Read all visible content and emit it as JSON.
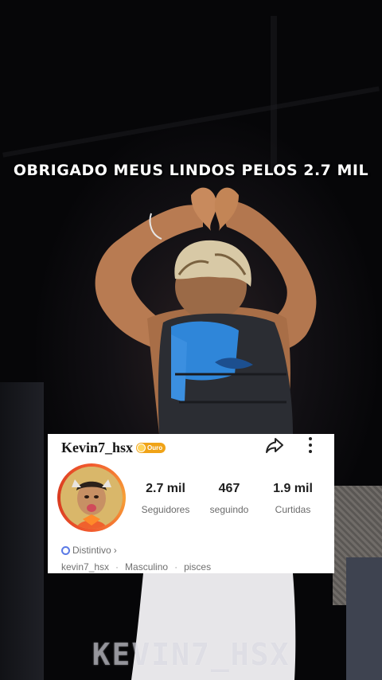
{
  "overlay": {
    "caption": "OBRIGADO MEUS LINDOS PELOS 2.7 MIL",
    "watermark": "KEVIN7_HSX"
  },
  "profile": {
    "username": "Kevin7_hsx",
    "badge_label": "Ouro",
    "stats": [
      {
        "value": "2.7 mil",
        "label": "Seguidores"
      },
      {
        "value": "467",
        "label": "seguindo"
      },
      {
        "value": "1.9 mil",
        "label": "Curtidas"
      }
    ],
    "distintivo_label": "Distintivo",
    "distintivo_chevron": "›",
    "info": {
      "handle": "kevin7_hsx",
      "gender": "Masculino",
      "sign": "pisces",
      "separator": "·"
    }
  },
  "colors": {
    "badge": "#f0a317",
    "avatar_ring": "#f25a2e",
    "distintivo_icon": "#5b7ae6"
  },
  "icons": [
    "share-icon",
    "more-vertical-icon",
    "distintivo-icon",
    "coin-icon"
  ]
}
